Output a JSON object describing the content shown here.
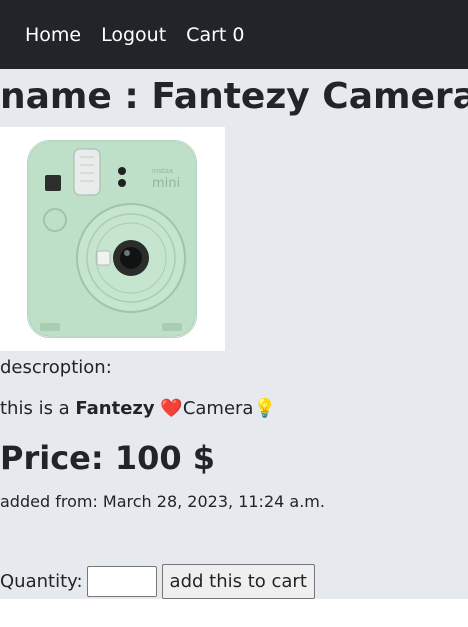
{
  "nav": {
    "home": "Home",
    "logout": "Logout",
    "cart": "Cart 0"
  },
  "product": {
    "title": "name : Fantezy Camera",
    "description_label": "descroption:",
    "description_prefix": "this is a ",
    "description_bold": "Fantezy",
    "description_heart": "❤️",
    "description_word": "Camera",
    "description_bulb": "💡",
    "price": "Price: 100 $",
    "added": "added from: March 28, 2023, 11:24 a.m."
  },
  "cart_form": {
    "quantity_label": "Quantity:",
    "quantity_value": "",
    "add_button": "add this to cart"
  },
  "colors": {
    "navbar": "#212529",
    "page_background": "#e6e9ed",
    "camera_body": "#bfe0c8"
  }
}
